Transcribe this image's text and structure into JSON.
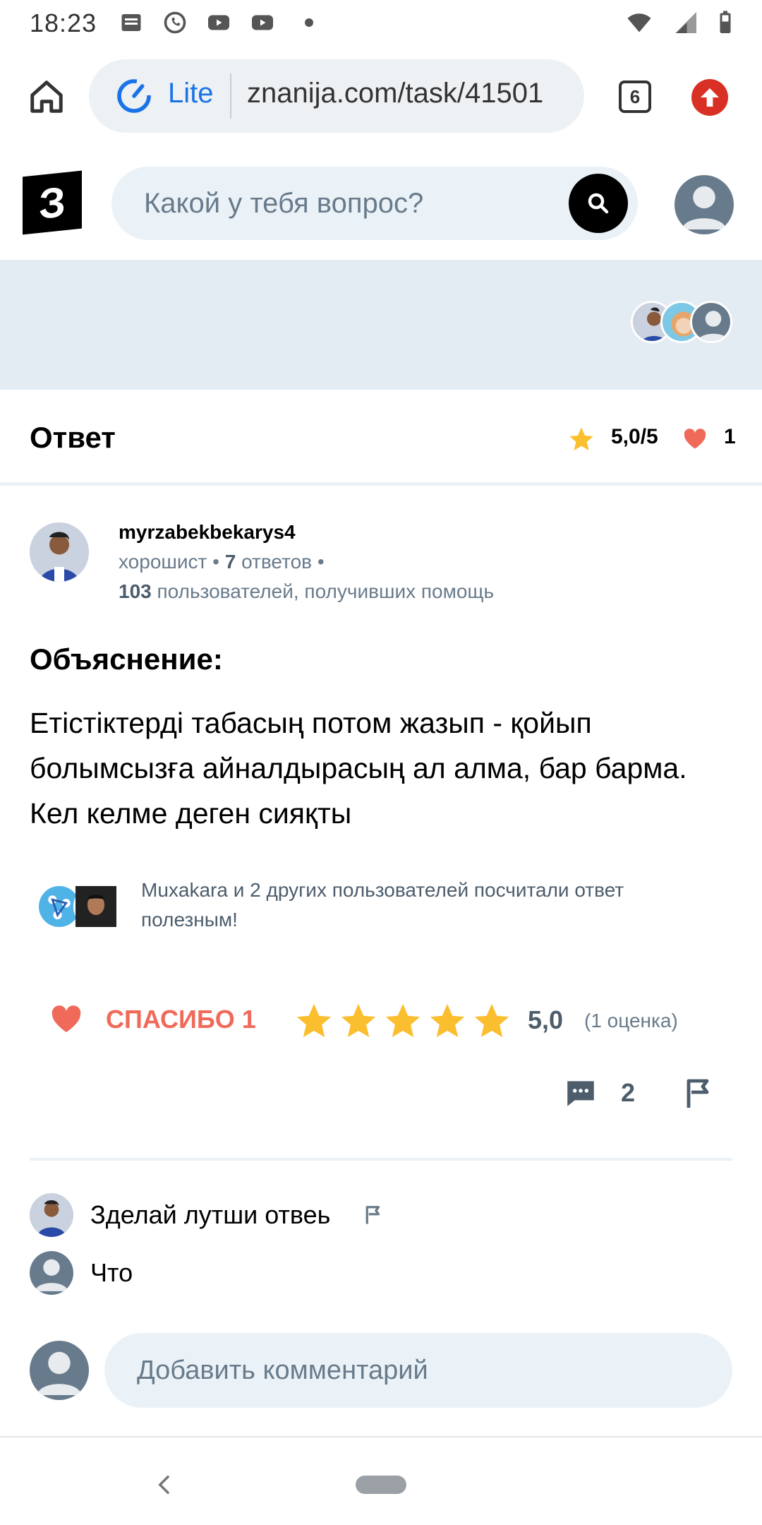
{
  "status_bar": {
    "time": "18:23"
  },
  "browser": {
    "lite_label": "Lite",
    "url": "znanija.com/task/41501",
    "tabs_count": "6"
  },
  "site": {
    "logo_text": "З",
    "search_placeholder": "Какой у тебя вопрос?"
  },
  "answer": {
    "title": "Ответ",
    "rating_summary": "5,0/5",
    "likes": "1",
    "author": {
      "name": "myrzabekbekarys4",
      "rank": "хорошист",
      "answers_count": "7",
      "answers_label": "ответов",
      "helped_count": "103",
      "helped_label": "пользователей, получивших помощь"
    },
    "explanation_title": "Объяснение:",
    "text": "Етістіктерді табасың потом жазып - қойып болымсызға айналдырасың ал алма, бар барма. Кел келме деген сияқты",
    "helpful_text": "Muxakara и 2 других пользователей посчитали ответ полезным!",
    "thanks_label": "СПАСИБО 1",
    "stars": 5,
    "rating_value": "5,0",
    "rating_count": "(1 оценка)",
    "comments_count": "2"
  },
  "comments": [
    {
      "text": "Зделай лутши отвеь"
    },
    {
      "text": "Что"
    }
  ],
  "add_comment_placeholder": "Добавить комментарий",
  "colors": {
    "accent": "#f06a5a",
    "star": "#fbbe2e",
    "muted": "#687b8c",
    "panel": "#ebf2f7"
  }
}
